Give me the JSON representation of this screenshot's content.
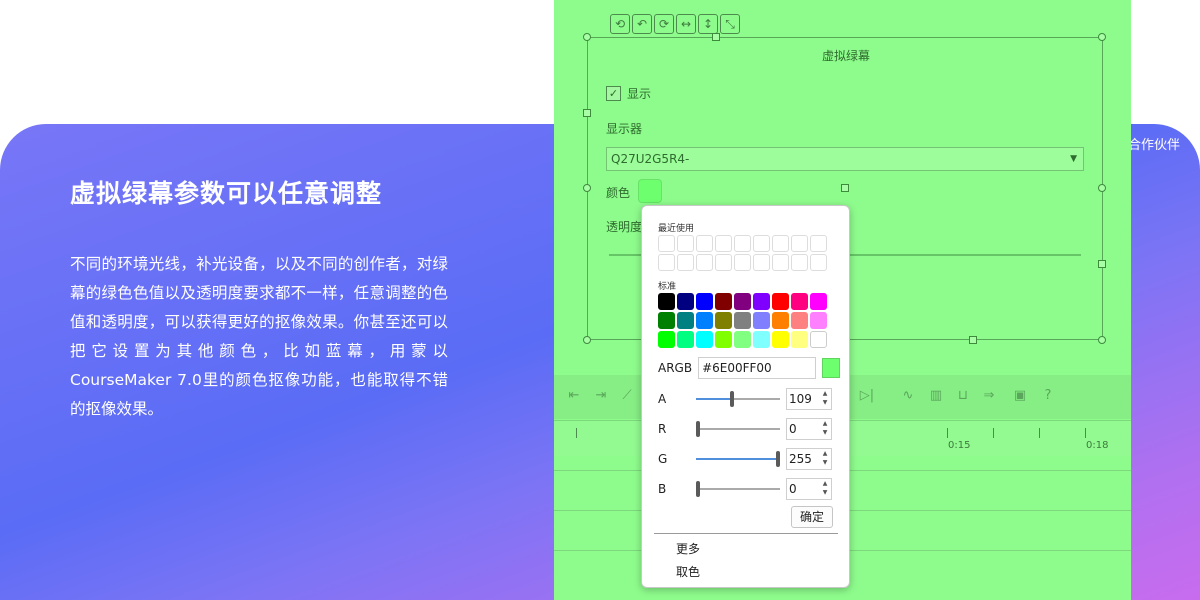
{
  "banner": {
    "title": "虚拟绿幕参数可以任意调整",
    "description": "不同的环境光线，补光设备，以及不同的创作者，对绿幕的绿色色值以及透明度要求都不一样，任意调整的色值和透明度，可以获得更好的抠像效果。你甚至还可以把它设置为其他颜色，比如蓝幕，用蒙以CourseMaker 7.0里的颜色抠像功能，也能取得不错的抠像效果。",
    "partner_label": "合作伙伴"
  },
  "panel": {
    "title": "虚拟绿幕",
    "show_label": "显示",
    "show_checked": true,
    "display_label": "显示器",
    "display_value": "Q27U2G5R4-",
    "color_label": "颜色",
    "transparency_label": "透明度",
    "color_value": "#6eff6e"
  },
  "timeline": {
    "tick_labels": [
      "0:15",
      "0:18"
    ]
  },
  "color_dialog": {
    "recent_label": "最近使用",
    "standard_label": "标准",
    "standard_colors": [
      "#000000",
      "#000080",
      "#0000ff",
      "#800000",
      "#800080",
      "#8000ff",
      "#ff0000",
      "#ff0080",
      "#ff00ff",
      "#008000",
      "#008080",
      "#0080ff",
      "#808000",
      "#808080",
      "#8080ff",
      "#ff8000",
      "#ff8080",
      "#ff80ff",
      "#00ff00",
      "#00ff80",
      "#00ffff",
      "#80ff00",
      "#80ff80",
      "#80ffff",
      "#ffff00",
      "#ffff80",
      "#ffffff"
    ],
    "argb_label": "ARGB",
    "argb_value": "#6E00FF00",
    "channels": [
      {
        "name": "A",
        "value": "109",
        "fraction": 0.43
      },
      {
        "name": "R",
        "value": "0",
        "fraction": 0.0
      },
      {
        "name": "G",
        "value": "255",
        "fraction": 1.0
      },
      {
        "name": "B",
        "value": "0",
        "fraction": 0.0
      }
    ],
    "ok_label": "确定",
    "more_label": "更多",
    "pick_label": "取色"
  }
}
